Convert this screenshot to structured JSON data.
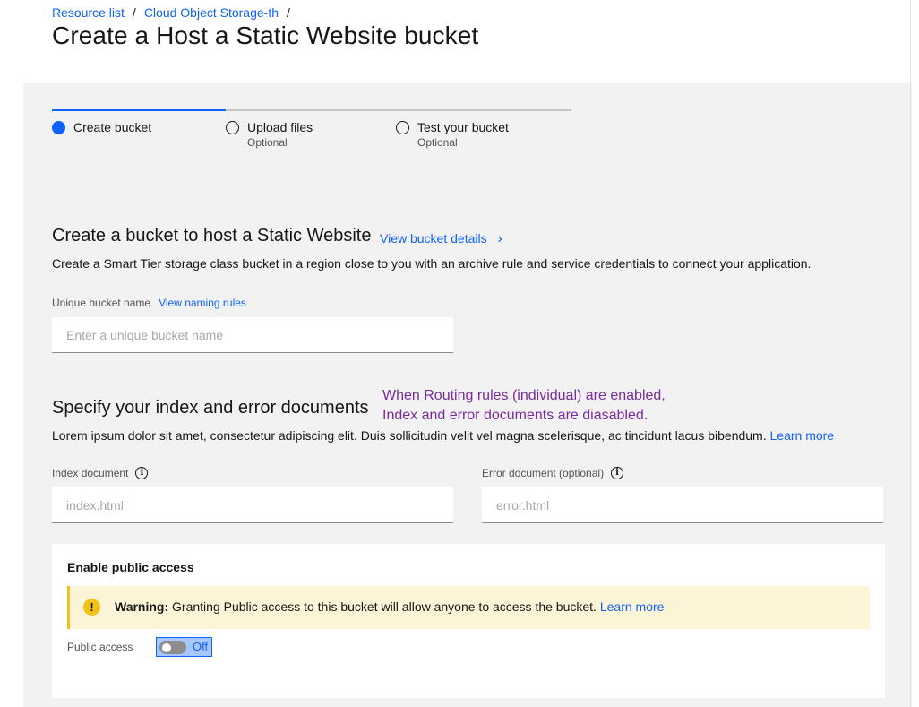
{
  "breadcrumb": {
    "items": [
      "Resource list",
      "Cloud Object Storage-th"
    ],
    "separator": "/"
  },
  "page_title": "Create a Host a Static Website bucket",
  "progress": {
    "steps": [
      {
        "label": "Create bucket",
        "optional": "",
        "state": "current"
      },
      {
        "label": "Upload files",
        "optional": "Optional",
        "state": "incomplete"
      },
      {
        "label": "Test your bucket",
        "optional": "Optional",
        "state": "incomplete"
      }
    ]
  },
  "section_bucket": {
    "title": "Create a bucket to host a Static Website",
    "details_link": "View bucket details",
    "chevron": "›",
    "description": "Create a Smart Tier storage class bucket in a region close to you with an archive rule and service credentials to connect your application.",
    "name_label": "Unique bucket name",
    "naming_link": "View naming rules",
    "name_placeholder": "Enter a unique bucket name"
  },
  "section_docs": {
    "title": "Specify your index and error documents",
    "annotation_line1": "When Routing rules (individual) are enabled,",
    "annotation_line2": "Index and error documents are diasabled.",
    "description": "Lorem ipsum dolor sit amet, consectetur adipiscing elit. Duis sollicitudin velit vel magna scelerisque, ac tincidunt lacus bibendum.",
    "learn_more": "Learn more",
    "index_label": "Index document",
    "index_placeholder": "index.html",
    "error_label": "Error document (optional)",
    "error_placeholder": "error.html",
    "info_glyph": "i"
  },
  "public_access": {
    "title": "Enable public access",
    "warning_glyph": "!",
    "warning_bold": "Warning:",
    "warning_text": "Granting Public access to this bucket will allow anyone to access the bucket.",
    "learn_more": "Learn more",
    "toggle_label": "Public access",
    "toggle_state": "Off"
  },
  "colors": {
    "link": "#0f62fe",
    "annotation": "#7a2a9c",
    "warning_bg": "#fcf4d6",
    "warning_accent": "#f1c21b",
    "panel_bg": "#f2f2f2"
  }
}
